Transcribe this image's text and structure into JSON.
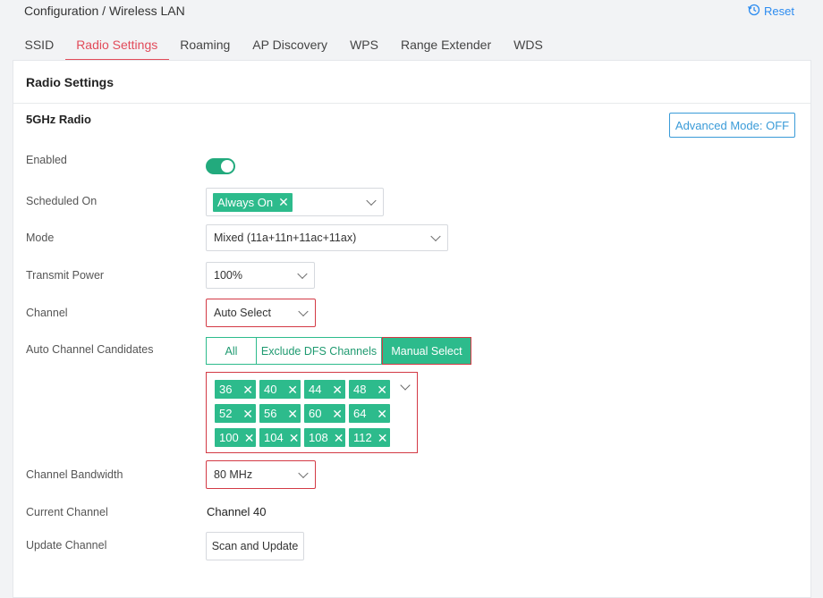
{
  "header": {
    "breadcrumb": "Configuration / Wireless LAN",
    "reset_label": "Reset",
    "reset_icon": "history-icon"
  },
  "tabs": [
    {
      "label": "SSID",
      "active": false
    },
    {
      "label": "Radio Settings",
      "active": true
    },
    {
      "label": "Roaming",
      "active": false
    },
    {
      "label": "AP Discovery",
      "active": false
    },
    {
      "label": "WPS",
      "active": false
    },
    {
      "label": "Range Extender",
      "active": false
    },
    {
      "label": "WDS",
      "active": false
    }
  ],
  "panel": {
    "title": "Radio Settings",
    "section_title": "5GHz Radio",
    "advanced_button": "Advanced Mode: OFF"
  },
  "form": {
    "enabled": {
      "label": "Enabled",
      "value": true
    },
    "scheduled": {
      "label": "Scheduled On",
      "tag": "Always On"
    },
    "mode": {
      "label": "Mode",
      "value": "Mixed (11a+11n+11ac+11ax)"
    },
    "transmit_power": {
      "label": "Transmit Power",
      "value": "100%"
    },
    "channel": {
      "label": "Channel",
      "value": "Auto Select"
    },
    "auto_channel": {
      "label": "Auto Channel Candidates",
      "options": [
        "All",
        "Exclude DFS Channels",
        "Manual Select"
      ],
      "selected": "Manual Select",
      "channels": [
        "36",
        "40",
        "44",
        "48",
        "52",
        "56",
        "60",
        "64",
        "100",
        "104",
        "108",
        "112"
      ]
    },
    "bandwidth": {
      "label": "Channel Bandwidth",
      "value": "80 MHz"
    },
    "current_channel": {
      "label": "Current Channel",
      "value": "Channel 40"
    },
    "update_channel": {
      "label": "Update Channel",
      "button": "Scan and Update"
    }
  },
  "colors": {
    "accent_green": "#2dbb8c",
    "tab_active": "#e24b5a",
    "link_blue": "#2d8cf0",
    "highlight_red": "#d33a45"
  }
}
